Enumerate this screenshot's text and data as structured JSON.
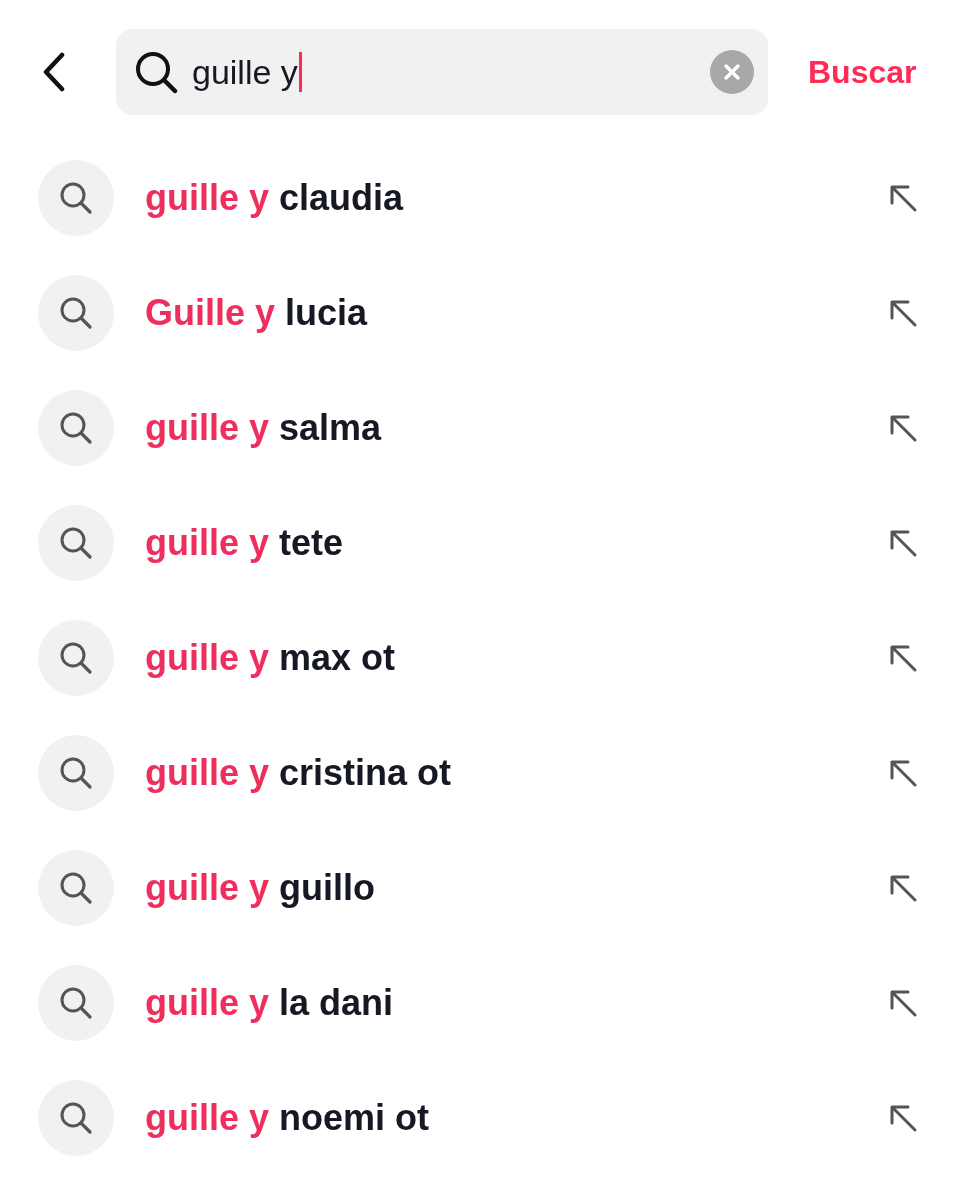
{
  "search": {
    "value": "guille y",
    "action": "Buscar"
  },
  "suggestions": [
    {
      "match": "guille y",
      "rest": "claudia"
    },
    {
      "match": "Guille y",
      "rest": "lucia"
    },
    {
      "match": "guille y",
      "rest": "salma"
    },
    {
      "match": "guille y",
      "rest": "tete"
    },
    {
      "match": "guille y",
      "rest": "max ot"
    },
    {
      "match": "guille y",
      "rest": "cristina ot"
    },
    {
      "match": "guille y",
      "rest": "guillo"
    },
    {
      "match": "guille y",
      "rest": "la dani"
    },
    {
      "match": "guille y",
      "rest": "noemi ot"
    }
  ]
}
